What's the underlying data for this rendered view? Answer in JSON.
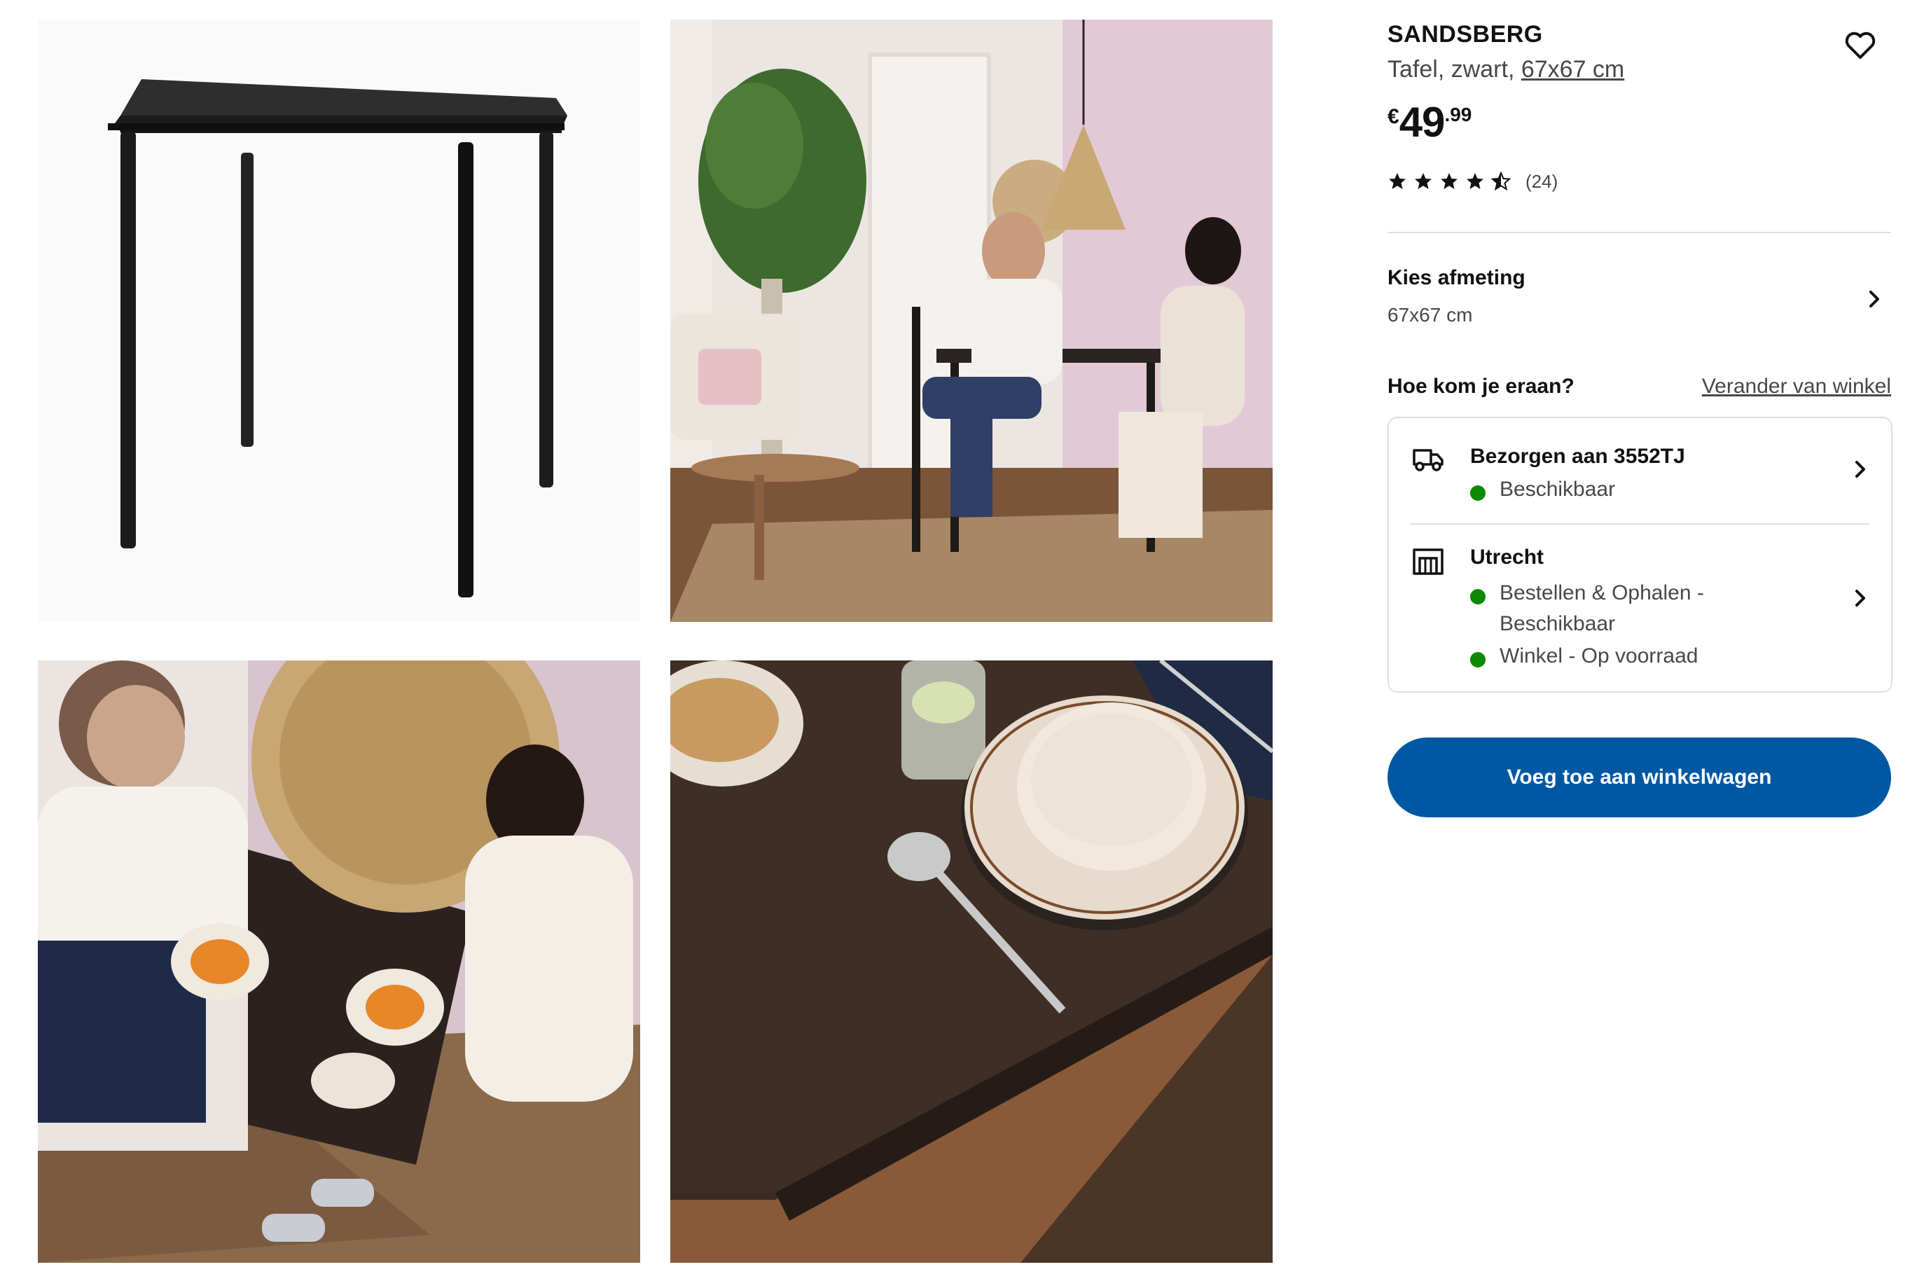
{
  "gallery": {
    "images": [
      {
        "alt": "Product image: black square table"
      },
      {
        "alt": "Room scene: couple at table"
      },
      {
        "alt": "Top view: lunch at table"
      },
      {
        "alt": "Detail: tabletop with plate and spoon"
      }
    ]
  },
  "product": {
    "name": "SANDSBERG",
    "desc_prefix": "Tafel, zwart, ",
    "desc_size": "67x67 cm",
    "price": {
      "currency": "€",
      "whole": "49",
      "decimal": ".99"
    },
    "rating": {
      "value": 4.5,
      "max": 5,
      "count_label": "(24)"
    }
  },
  "size_selector": {
    "label": "Kies afmeting",
    "value": "67x67 cm"
  },
  "availability": {
    "heading": "Hoe kom je eraan?",
    "change_store": "Verander van winkel",
    "delivery": {
      "title": "Bezorgen aan 3552TJ",
      "status": "Beschikbaar",
      "icon": "truck-icon"
    },
    "store": {
      "title": "Utrecht",
      "statuses": [
        "Bestellen & Ophalen - Beschikbaar",
        "Winkel - Op voorraad"
      ],
      "icon": "store-icon"
    },
    "status_color": "#0a8a00"
  },
  "cta": {
    "label": "Voeg toe aan winkelwagen",
    "color": "#0058a3"
  }
}
